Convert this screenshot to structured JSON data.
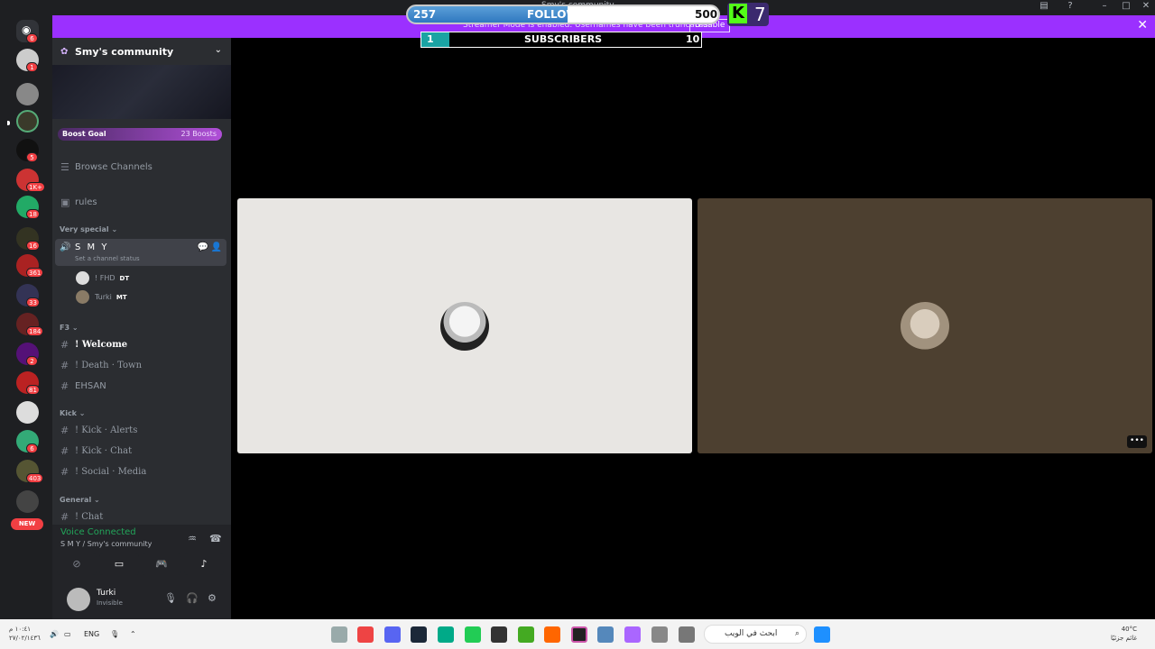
{
  "window": {
    "title": "Smy's community"
  },
  "streamer_banner": {
    "text": "Streamer Mode is enabled. Usernames have been truncated.",
    "disable_label": "Disable"
  },
  "overlay": {
    "followers": {
      "current": "257",
      "label": "FOLLOWERS",
      "goal": "500",
      "progress": 0.514
    },
    "kick_count": "7",
    "subscribers": {
      "current": "1",
      "label": "SUBSCRIBERS",
      "goal": "10",
      "progress": 0.1
    }
  },
  "servers": {
    "badges": [
      "6",
      "1",
      "5",
      "1K+",
      "18",
      "16",
      "361",
      "33",
      "184",
      "2",
      "81",
      "6",
      "403"
    ],
    "new_label": "NEW"
  },
  "sidebar": {
    "server_name": "Smy's community",
    "boost_goal": "Boost Goal",
    "boost_count": "23 Boosts",
    "browse_channels": "Browse Channels",
    "rules": "rules",
    "categories": {
      "very_special": "Very special",
      "f3": "F3",
      "kick": "Kick",
      "general": "General"
    },
    "voice_channel": {
      "name": "S M Y",
      "status": "Set a channel status",
      "users": [
        {
          "name": "! FHD",
          "tag": "DT"
        },
        {
          "name": "Turki",
          "tag": "MT"
        }
      ]
    },
    "text_channels": {
      "welcome": "! Welcome",
      "death_town": "! Death · Town",
      "ehsan": "EHSAN",
      "kick_alerts": "! Kick · Alerts",
      "kick_chat": "! Kick · Chat",
      "social_media": "! Social · Media",
      "chat": "! Chat"
    }
  },
  "voice_panel": {
    "status": "Voice Connected",
    "location": "S M Y / Smy's community"
  },
  "user_panel": {
    "username": "Turki",
    "status": "Invisible"
  },
  "taskbar": {
    "time": "١٠:٤١ م",
    "date": "٢٧/٠٢/١٤٣٦",
    "lang": "ENG",
    "search_placeholder": "ابحث في الويب",
    "temp": "40°C",
    "weather": "غائم جزئيًا"
  },
  "colors": {
    "banner": "#9b30ff",
    "accent_green": "#23a55a",
    "kick_green": "#53fc18"
  }
}
